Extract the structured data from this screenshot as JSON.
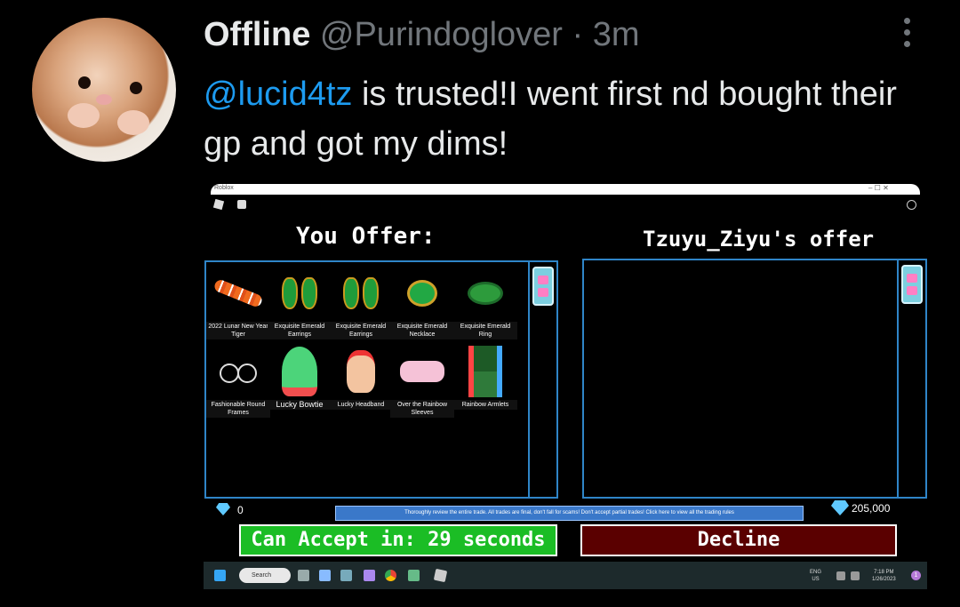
{
  "tweet": {
    "display_name": "Offline",
    "handle": "@Purindoglover",
    "separator": "·",
    "time": "3m",
    "mention": "@lucid4tz",
    "text": " is trusted!I went first nd bought their gp and got my dims!"
  },
  "screenshot": {
    "window_title": "Roblox",
    "window_controls": "–  ☐  ✕",
    "you_offer_title": "You Offer:",
    "their_offer_title": "Tzuyu_Ziyu's offer",
    "items": [
      {
        "label": "2022 Lunar New Year Tiger",
        "icon": "tiger-plush"
      },
      {
        "label": "Exquisite Emerald Earrings",
        "icon": "emerald-earrings"
      },
      {
        "label": "Exquisite Emerald Earrings",
        "icon": "emerald-earrings"
      },
      {
        "label": "Exquisite Emerald Necklace",
        "icon": "emerald-necklace"
      },
      {
        "label": "Exquisite Emerald Ring",
        "icon": "emerald-ring"
      },
      {
        "label": "Fashionable Round Frames",
        "icon": "round-glasses"
      },
      {
        "label": "Lucky Bowtie",
        "icon": "lucky-bowtie-avatar"
      },
      {
        "label": "Lucky Headband",
        "icon": "lucky-headband"
      },
      {
        "label": "Over the Rainbow Sleeves",
        "icon": "rainbow-sleeves"
      },
      {
        "label": "Rainbow Armlets",
        "icon": "rainbow-armlets"
      }
    ],
    "your_diamonds": "0",
    "their_diamonds": "205,000",
    "notice": "Thoroughly review the entire trade. All trades are final, don't fall for scams! Don't accept partial trades! Click here to view all the trading rules",
    "accept_button": "Can Accept in: 29 seconds",
    "decline_button": "Decline",
    "accept_color": "#1bbd25",
    "decline_color": "#5a0000",
    "panel_border_color": "#2f85c8"
  },
  "taskbar": {
    "search_label": "Search",
    "tray_lang": "ENG",
    "tray_region": "US",
    "clock_time": "7:18 PM",
    "clock_date": "1/26/2023",
    "notification_count": "1"
  }
}
